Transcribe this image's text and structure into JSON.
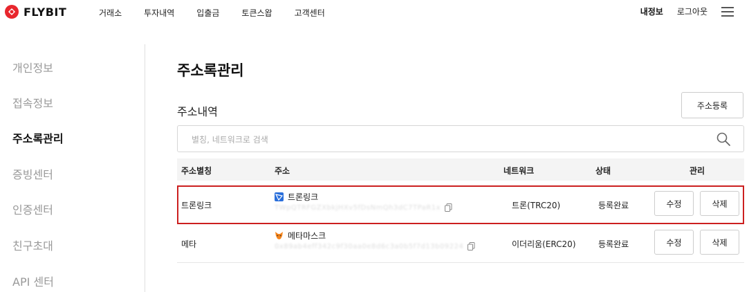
{
  "header": {
    "logo_text": "FLYBIT",
    "nav": [
      "거래소",
      "투자내역",
      "입출금",
      "토큰스왑",
      "고객센터"
    ],
    "mypage": "내정보",
    "logout": "로그아웃"
  },
  "sidebar": {
    "items": [
      {
        "label": "개인정보"
      },
      {
        "label": "접속정보"
      },
      {
        "label": "주소록관리"
      },
      {
        "label": "증빙센터"
      },
      {
        "label": "인증센터"
      },
      {
        "label": "친구초대"
      },
      {
        "label": "API 센터"
      }
    ],
    "active": "주소록관리"
  },
  "main": {
    "title": "주소록관리",
    "section_title": "주소내역",
    "register_label": "주소등록",
    "search": {
      "placeholder": "별칭, 네트워크로 검색",
      "value": ""
    },
    "table": {
      "headers": [
        "주소별칭",
        "주소",
        "네트워크",
        "상태",
        "관리"
      ],
      "rows": [
        {
          "alias": "트론링크",
          "wallet": "트론링크",
          "wallet_icon": "tronlink-icon",
          "address": "TWpQTRFGZXbkjHXv5fDsNmQh3dC7TPaR1x",
          "network": "트론(TRC20)",
          "status": "등록완료",
          "edit": "수정",
          "delete": "삭제"
        },
        {
          "alias": "메타",
          "wallet": "메타마스크",
          "wallet_icon": "metamask-fox-icon",
          "address": "0x89ab4eff342c9f30aa0e8d6c3a0b5f7d13b09224",
          "network": "이더리움(ERC20)",
          "status": "등록완료",
          "edit": "수정",
          "delete": "삭제"
        }
      ]
    }
  },
  "colors": {
    "highlight_border": "#cc1f1f",
    "logo_red": "#e8262d",
    "table_header_bg": "#f4f4f4"
  }
}
